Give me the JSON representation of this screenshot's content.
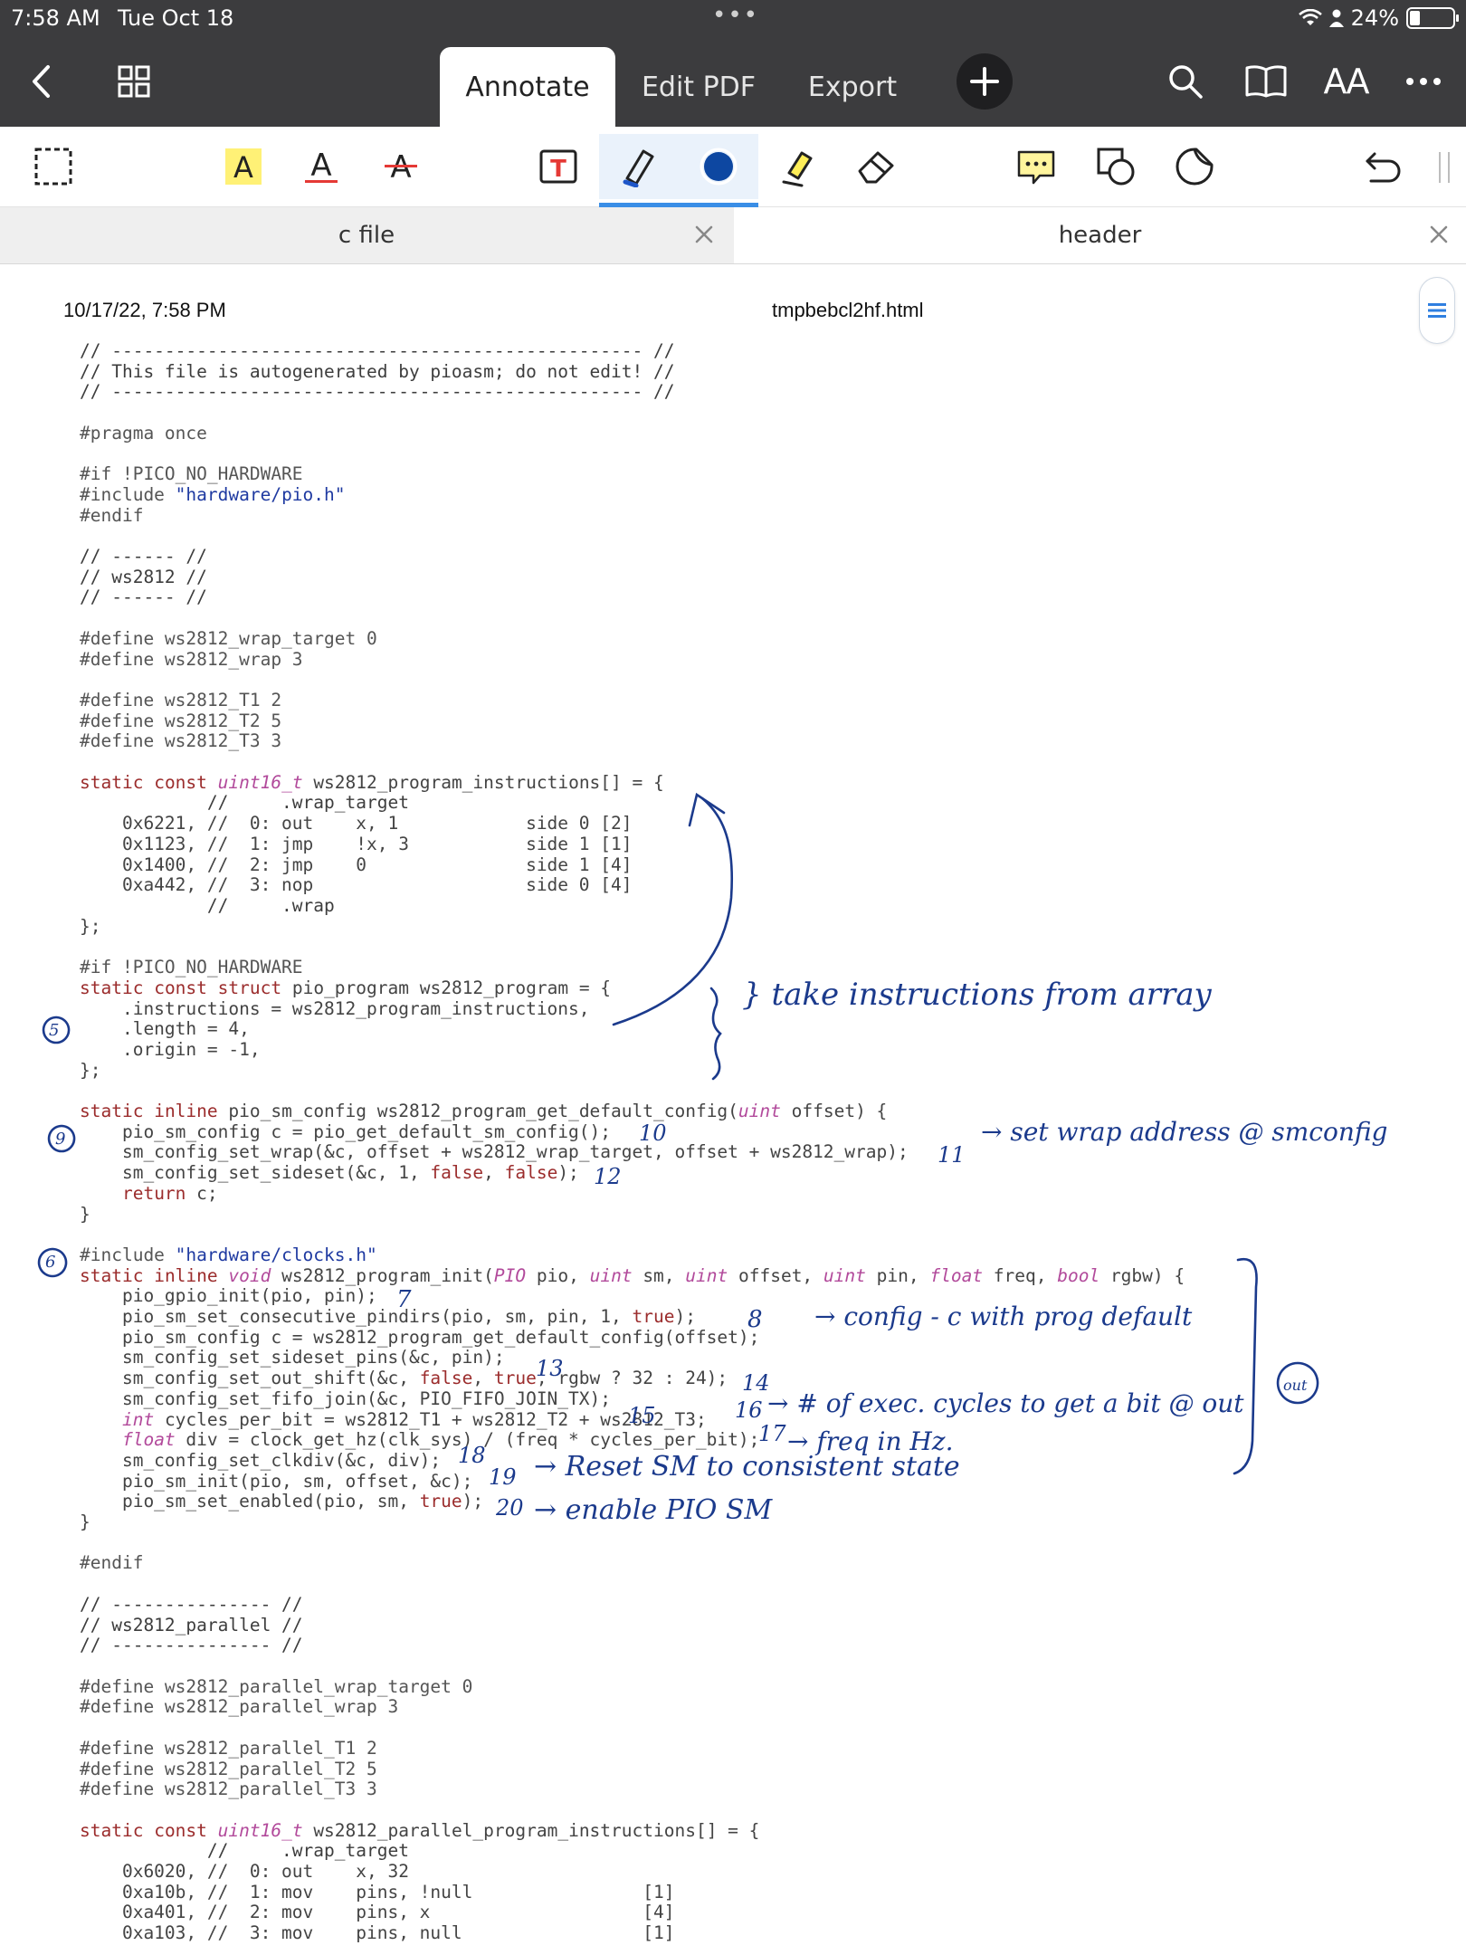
{
  "status_bar": {
    "time": "7:58 AM",
    "date": "Tue Oct 18",
    "battery": "24%",
    "battery_level": 0.24
  },
  "nav": {
    "tabs": [
      {
        "label": "Annotate",
        "active": true
      },
      {
        "label": "Edit PDF",
        "active": false
      },
      {
        "label": "Export",
        "active": false
      }
    ],
    "icons": [
      "back-chevron-icon",
      "grid-icon",
      "plus-icon",
      "search-icon",
      "book-icon",
      "text-size-icon",
      "more-icon"
    ],
    "text_size_label": "AA"
  },
  "toolbar": {
    "tools": [
      "select-icon",
      "highlight-text-icon",
      "underline-text-icon",
      "strikethrough-text-icon",
      "text-box-icon",
      "pen-icon",
      "color-icon",
      "highlighter-icon",
      "eraser-icon",
      "comment-icon",
      "shapes-icon",
      "sticker-icon",
      "undo-icon"
    ],
    "text_glyph": "A",
    "textbox_glyph": "T",
    "accent_color": "#3a8ee6",
    "pen_color": "#0d47a1",
    "highlight_color": "#fff176"
  },
  "doc_tabs": [
    {
      "label": "c file"
    },
    {
      "label": "header"
    }
  ],
  "page_header": {
    "date": "10/17/22, 7:58 PM",
    "filename": "tmpbebcl2hf.html"
  },
  "code_lines": [
    "// -------------------------------------------------- //",
    "// This file is autogenerated by pioasm; do not edit! //",
    "// -------------------------------------------------- //",
    "",
    "#pragma once",
    "",
    "#if !PICO_NO_HARDWARE",
    "#include \"hardware/pio.h\"",
    "#endif",
    "",
    "// ------ //",
    "// ws2812 //",
    "// ------ //",
    "",
    "#define ws2812_wrap_target 0",
    "#define ws2812_wrap 3",
    "",
    "#define ws2812_T1 2",
    "#define ws2812_T2 5",
    "#define ws2812_T3 3",
    "",
    "static const uint16_t ws2812_program_instructions[] = {",
    "            //     .wrap_target",
    "    0x6221, //  0: out    x, 1            side 0 [2]",
    "    0x1123, //  1: jmp    !x, 3           side 1 [1]",
    "    0x1400, //  2: jmp    0               side 1 [4]",
    "    0xa442, //  3: nop                    side 0 [4]",
    "            //     .wrap",
    "};",
    "",
    "#if !PICO_NO_HARDWARE",
    "static const struct pio_program ws2812_program = {",
    "    .instructions = ws2812_program_instructions,",
    "    .length = 4,",
    "    .origin = -1,",
    "};",
    "",
    "static inline pio_sm_config ws2812_program_get_default_config(uint offset) {",
    "    pio_sm_config c = pio_get_default_sm_config();",
    "    sm_config_set_wrap(&c, offset + ws2812_wrap_target, offset + ws2812_wrap);",
    "    sm_config_set_sideset(&c, 1, false, false);",
    "    return c;",
    "}",
    "",
    "#include \"hardware/clocks.h\"",
    "static inline void ws2812_program_init(PIO pio, uint sm, uint offset, uint pin, float freq, bool rgbw) {",
    "    pio_gpio_init(pio, pin);",
    "    pio_sm_set_consecutive_pindirs(pio, sm, pin, 1, true);",
    "    pio_sm_config c = ws2812_program_get_default_config(offset);",
    "    sm_config_set_sideset_pins(&c, pin);",
    "    sm_config_set_out_shift(&c, false, true, rgbw ? 32 : 24);",
    "    sm_config_set_fifo_join(&c, PIO_FIFO_JOIN_TX);",
    "    int cycles_per_bit = ws2812_T1 + ws2812_T2 + ws2812_T3;",
    "    float div = clock_get_hz(clk_sys) / (freq * cycles_per_bit);",
    "    sm_config_set_clkdiv(&c, div);",
    "    pio_sm_init(pio, sm, offset, &c);",
    "    pio_sm_set_enabled(pio, sm, true);",
    "}",
    "",
    "#endif",
    "",
    "// --------------- //",
    "// ws2812_parallel //",
    "// --------------- //",
    "",
    "#define ws2812_parallel_wrap_target 0",
    "#define ws2812_parallel_wrap 3",
    "",
    "#define ws2812_parallel_T1 2",
    "#define ws2812_parallel_T2 5",
    "#define ws2812_parallel_T3 3",
    "",
    "static const uint16_t ws2812_parallel_program_instructions[] = {",
    "            //     .wrap_target",
    "    0x6020, //  0: out    x, 32",
    "    0xa10b, //  1: mov    pins, !null                [1]",
    "    0xa401, //  2: mov    pins, x                    [4]",
    "    0xa103, //  3: mov    pins, null                 [1]"
  ],
  "annotations": {
    "take_instructions": "} take instructions from array",
    "set_wrap": "→ set wrap address @ smconfig",
    "config": "→ config - c with prog default",
    "cycles": "→ # of exec. cycles to get a bit @ out",
    "freq": "→ freq in Hz.",
    "reset": "→ Reset SM to consistent state",
    "enable": "→ enable PIO SM",
    "num_5": "5",
    "num_9": "9",
    "num_6": "6",
    "num_7": "7",
    "num_8": "8",
    "num_10": "10",
    "num_11": "11",
    "num_12": "12",
    "num_13": "13",
    "num_14": "14",
    "num_15": "15",
    "num_16": "16",
    "num_17": "17",
    "num_18": "18",
    "num_19": "19",
    "num_20": "20",
    "circled_out": "out"
  }
}
